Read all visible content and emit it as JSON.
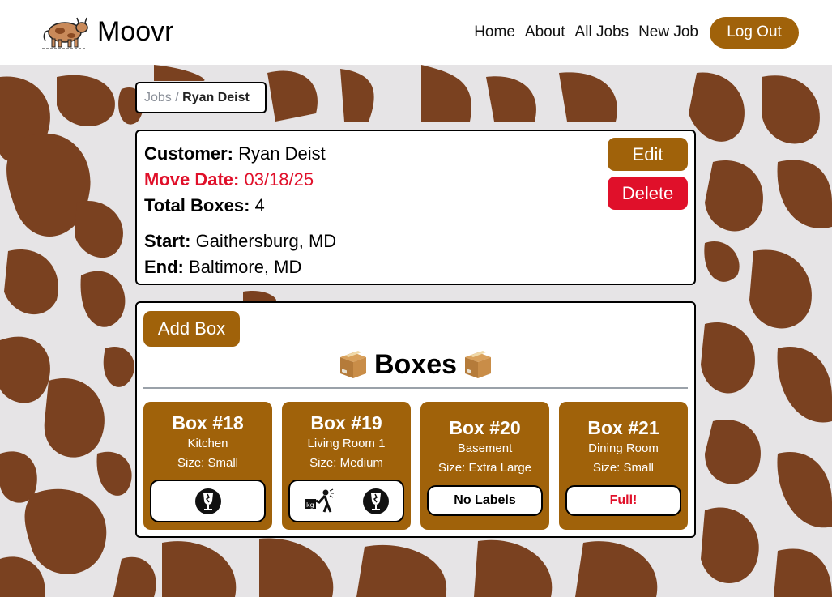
{
  "app": {
    "name": "Moovr"
  },
  "nav": {
    "links": [
      "Home",
      "About",
      "All Jobs",
      "New Job"
    ],
    "logout_label": "Log Out"
  },
  "breadcrumb": {
    "parent": "Jobs",
    "separator": "/",
    "current": "Ryan Deist"
  },
  "job": {
    "customer_label": "Customer:",
    "customer": "Ryan Deist",
    "move_date_label": "Move Date:",
    "move_date": "03/18/25",
    "total_boxes_label": "Total Boxes:",
    "total_boxes": "4",
    "start_label": "Start:",
    "start": "Gaithersburg, MD",
    "end_label": "End:",
    "end": "Baltimore, MD",
    "edit_label": "Edit",
    "delete_label": "Delete"
  },
  "boxes_section": {
    "add_label": "Add Box",
    "title": "Boxes",
    "title_icon": "package-icon",
    "boxes": [
      {
        "name": "Box #18",
        "room": "Kitchen",
        "size": "Size: Small",
        "labels": [
          "fragile-icon"
        ]
      },
      {
        "name": "Box #19",
        "room": "Living Room 1",
        "size": "Size: Medium",
        "labels": [
          "heavy-lift-icon",
          "fragile-icon"
        ]
      },
      {
        "name": "Box #20",
        "room": "Basement",
        "size": "Size: Extra Large",
        "label_text": "No Labels"
      },
      {
        "name": "Box #21",
        "room": "Dining Room",
        "size": "Size: Small",
        "label_text": "Full!"
      }
    ]
  },
  "colors": {
    "accent": "#a0620a",
    "danger": "#e0102a",
    "cow_spot": "#7a4120",
    "background": "#e6e4e6"
  }
}
